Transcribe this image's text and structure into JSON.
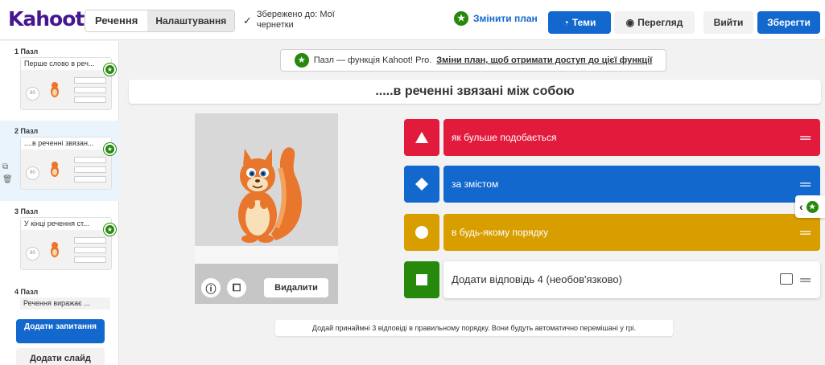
{
  "header": {
    "logo": "Kahoot!",
    "tabs": [
      {
        "label": "Речення"
      },
      {
        "label": "Налаштування"
      }
    ],
    "saved_status": "Збережено до: Мої чернетки",
    "change_plan": "Змінити план",
    "themes": "Теми",
    "preview": "Перегляд",
    "exit": "Вийти",
    "save": "Зберегти"
  },
  "sidebar": {
    "slides": [
      {
        "header": "1 Пазл",
        "title": "Перше слово в реч..."
      },
      {
        "header": "2 Пазл",
        "title": "....в реченні звязан..."
      },
      {
        "header": "3 Пазл",
        "title": "У кінці речення ст..."
      },
      {
        "header": "4 Пазл",
        "title": "Речення виражає ..."
      }
    ],
    "thumb_timer": "60",
    "add_question": "Додати запитання",
    "add_slide": "Додати слайд"
  },
  "editor": {
    "notice_text": "Пазл — функція Kahoot! Pro.",
    "notice_link": "Зміни план, щоб отримати доступ до цієї функції",
    "question": ".....в реченні звязані між собою",
    "delete_media": "Видалити",
    "answers": [
      {
        "text": "як бульше подобається",
        "color": "#e21b3c",
        "shape": "triangle"
      },
      {
        "text": "за змістом",
        "color": "#1368ce",
        "shape": "diamond"
      },
      {
        "text": "в будь-якому порядку",
        "color": "#d89e00",
        "shape": "circle"
      },
      {
        "text": "Додати відповідь 4 (необов'язково)",
        "color": "#26890c",
        "shape": "square"
      }
    ],
    "hint": "Додай принаймні 3 відповіді в правильному порядку. Вони будуть автоматично перемішані у грі."
  }
}
